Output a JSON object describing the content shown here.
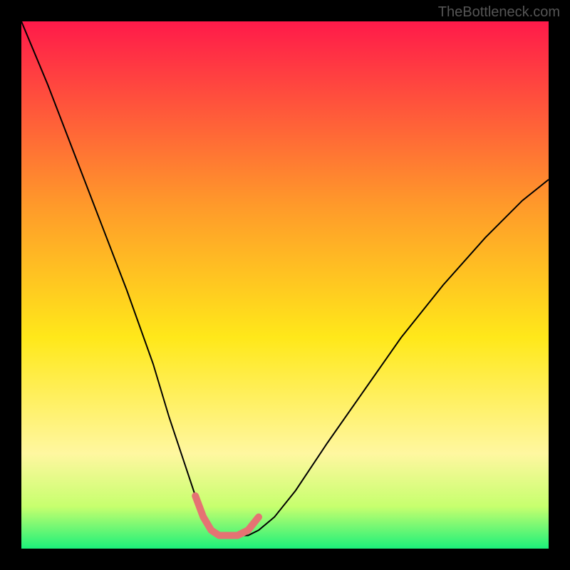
{
  "watermark": "TheBottleneck.com",
  "chart_data": {
    "type": "line",
    "title": "",
    "xlabel": "",
    "ylabel": "",
    "xlim": [
      0,
      100
    ],
    "ylim": [
      0,
      100
    ],
    "background": {
      "type": "vertical_gradient",
      "stops": [
        {
          "offset": 0,
          "color": "#ff1a4a"
        },
        {
          "offset": 35,
          "color": "#ff9a2a"
        },
        {
          "offset": 60,
          "color": "#ffe81a"
        },
        {
          "offset": 82,
          "color": "#fff7a0"
        },
        {
          "offset": 92,
          "color": "#c7ff6e"
        },
        {
          "offset": 100,
          "color": "#1cf07a"
        }
      ]
    },
    "series": [
      {
        "name": "bottleneck-curve",
        "color": "#000000",
        "stroke_width": 2,
        "x": [
          0,
          5,
          10,
          15,
          20,
          25,
          28,
          31,
          33,
          34.5,
          36,
          37.5,
          39,
          43,
          45,
          48,
          52,
          58,
          65,
          72,
          80,
          88,
          95,
          100
        ],
        "y": [
          100,
          88,
          75,
          62,
          49,
          35,
          25,
          16,
          10,
          6,
          3.5,
          2.5,
          2.5,
          2.5,
          3.5,
          6,
          11,
          20,
          30,
          40,
          50,
          59,
          66,
          70
        ]
      },
      {
        "name": "optimal-zone",
        "color": "#e57373",
        "stroke_width": 10,
        "linecap": "round",
        "x": [
          33,
          34.5,
          36,
          37.5,
          39,
          41,
          43,
          45
        ],
        "y": [
          10,
          6,
          3.5,
          2.5,
          2.5,
          2.5,
          3.5,
          6
        ]
      }
    ]
  }
}
